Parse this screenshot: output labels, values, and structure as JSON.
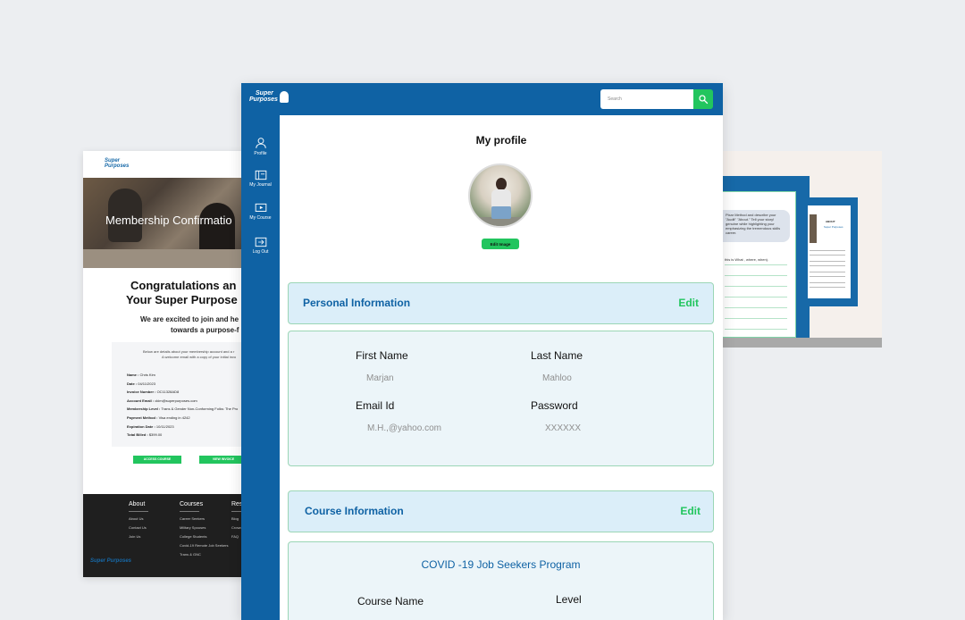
{
  "email_preview": {
    "logo": "Super Purposes",
    "hero_title": "Membership Confirmatio",
    "heading_line1": "Congratulations an",
    "heading_line2": "Your Super Purpose",
    "sub_line1": "We are excited to join and he",
    "sub_line2": "towards a purpose-f",
    "intro_line1": "Below are details about your membership account and a r",
    "intro_line2": "A welcome email with a copy of your initial invo",
    "details": [
      {
        "label": "Name :",
        "value": " Chris Kim"
      },
      {
        "label": "Date :",
        "value": " 04/11/2023"
      },
      {
        "label": "Invoice Number :",
        "value": " OC11328AD8"
      },
      {
        "label": "Account Email :",
        "value": " ckim@superpurposes.com"
      },
      {
        "label": "Membership Level :",
        "value": " Trans & Gender Non-Conforming Folks: The Pro"
      },
      {
        "label": "Payment Method :",
        "value": " Visa ending in 4242"
      },
      {
        "label": "Expiration Date :",
        "value": " 10/11/2023"
      },
      {
        "label": "Total Billed :",
        "value": " $399.00"
      }
    ],
    "buttons": {
      "access": "ACCESS COURSE",
      "invoice": "VIEW INVOICE"
    },
    "footer": {
      "about_title": "About",
      "about_links": [
        "About Us",
        "Contact Us",
        "Join Us"
      ],
      "courses_title": "Courses",
      "courses_links": [
        "Career Seekers",
        "Military Spouses",
        "College Students",
        "Covid-19 Remote Job Seekers",
        "Trans & GNC"
      ],
      "res_title": "Res",
      "res_links": [
        "Blog",
        "Crowd",
        "FAQ"
      ],
      "logo": "Super Purposes"
    }
  },
  "journal_preview": {
    "bubble_text": "Pixar Method and describe your \"Audit\" \"About.\" Tell your story! genuine while highlighting your emphasizing the tremendous skills career.",
    "note": "this is What , where, when).",
    "about_title": "ABOUT",
    "about_sub": "Super Purposes"
  },
  "app": {
    "logo_line1": "Super",
    "logo_line2": "Purposes",
    "search": {
      "placeholder": "Search"
    },
    "sidebar": [
      {
        "label": "Profile",
        "icon": "user-icon"
      },
      {
        "label": "My Journal",
        "icon": "journal-icon"
      },
      {
        "label": "My Course",
        "icon": "course-icon"
      },
      {
        "label": "Log Out",
        "icon": "logout-icon"
      }
    ],
    "page_title": "My profile",
    "edit_image_label": "Edit Image",
    "personal": {
      "title": "Personal Information",
      "edit": "Edit",
      "first_name_label": "First Name",
      "first_name": "Marjan",
      "last_name_label": "Last Name",
      "last_name": "Mahloo",
      "email_label": "Email Id",
      "email": "M.H.,@yahoo.com",
      "password_label": "Password",
      "password": "XXXXXX"
    },
    "course": {
      "title": "Course Information",
      "edit": "Edit",
      "program": "COVID -19 Job  Seekers Program",
      "course_name_label": "Course Name",
      "level_label": "Level"
    },
    "colors": {
      "primary": "#0f62a4",
      "accent": "#22c55e",
      "section_bg": "#dbeef9",
      "body_bg": "#ecf5f9"
    }
  }
}
